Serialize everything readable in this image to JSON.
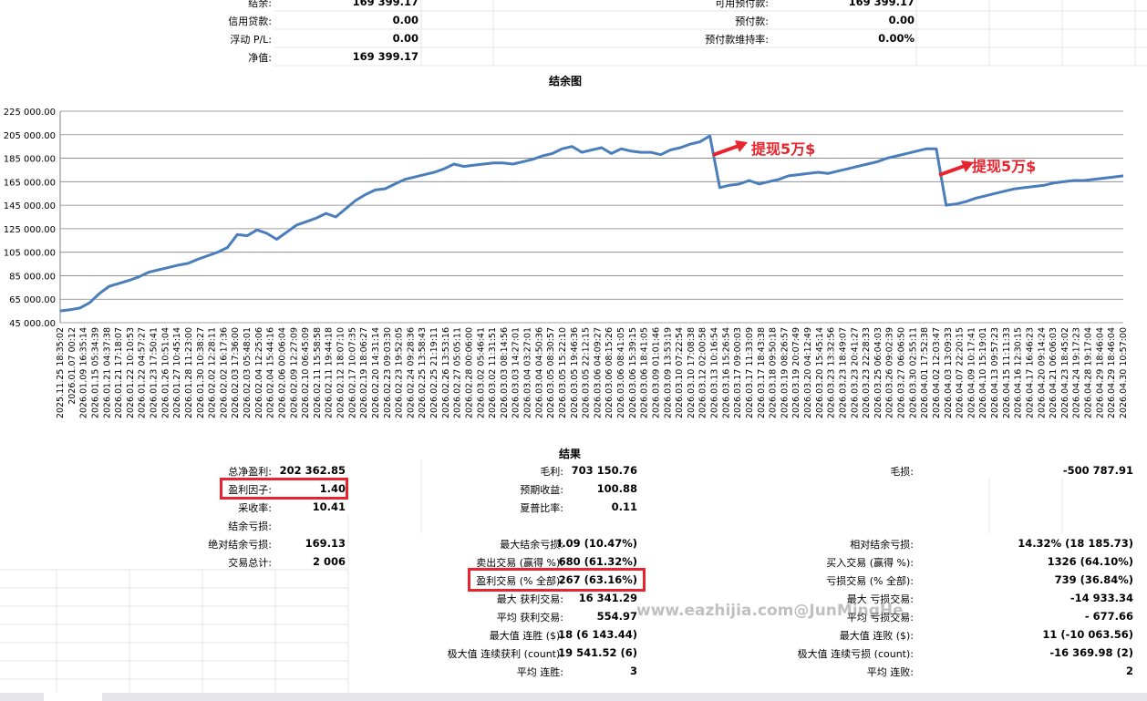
{
  "summary_top": [
    {
      "left_label": "结余:",
      "left_value": "169 399.17",
      "right_label": "可用预付款:",
      "right_value": "169 399.17"
    },
    {
      "left_label": "信用贷款:",
      "left_value": "0.00",
      "right_label": "预付款:",
      "right_value": "0.00"
    },
    {
      "left_label": "浮动 P/L:",
      "left_value": "0.00",
      "right_label": "预付款维持率:",
      "right_value": "0.00%"
    },
    {
      "left_label": "净值:",
      "left_value": "169 399.17",
      "right_label": "",
      "right_value": ""
    }
  ],
  "chart_title": "结余图",
  "annotations": {
    "withdraw1": "提现5万$",
    "withdraw2": "提现5万$"
  },
  "watermark": "www.eazhijia.com@JunMingHe",
  "results_title": "结果",
  "col1": [
    {
      "label": "总净盈利:",
      "value": "202 362.85"
    },
    {
      "label": "盈利因子:",
      "value": "1.40"
    },
    {
      "label": "采收率:",
      "value": "10.41"
    },
    {
      "label": "结余亏损:",
      "value": ""
    },
    {
      "label": "绝对结余亏损:",
      "value": "169.13"
    },
    {
      "label": "交易总计:",
      "value": "2 006"
    }
  ],
  "col2": [
    {
      "label": "毛利:",
      "value": "703 150.76"
    },
    {
      "label": "预期收益:",
      "value": "100.88"
    },
    {
      "label": "夏普比率:",
      "value": "0.11"
    },
    {
      "label": "",
      "value": ""
    },
    {
      "label": "最大结余亏损:",
      "value": "I.09 (10.47%)"
    },
    {
      "label": "卖出交易 (赢得 %):",
      "value": "680 (61.32%)"
    },
    {
      "label": "盈利交易 (% 全部):",
      "value": "267 (63.16%)"
    },
    {
      "label": "最大 获利交易:",
      "value": "16 341.29"
    },
    {
      "label": "平均 获利交易:",
      "value": "554.97"
    },
    {
      "label": "最大值 连胜 ($):",
      "value": "18 (6 143.44)"
    },
    {
      "label": "极大值 连续获利 (count):",
      "value": "19 541.52 (6)"
    },
    {
      "label": "平均 连胜:",
      "value": "3"
    }
  ],
  "col3": [
    {
      "label": "毛损:",
      "value": "-500 787.91"
    },
    {
      "label": "",
      "value": ""
    },
    {
      "label": "",
      "value": ""
    },
    {
      "label": "",
      "value": ""
    },
    {
      "label": "相对结余亏损:",
      "value": "14.32% (18 185.73)"
    },
    {
      "label": "买入交易 (赢得 %):",
      "value": "1326 (64.10%)"
    },
    {
      "label": "亏损交易 (% 全部):",
      "value": "739 (36.84%)"
    },
    {
      "label": "最大 亏损交易:",
      "value": "-14 933.34"
    },
    {
      "label": "平均 亏损交易:",
      "value": "- 677.66"
    },
    {
      "label": "最大值 连败 ($):",
      "value": "11 (-10 063.56)"
    },
    {
      "label": "极大值 连续亏损 (count):",
      "value": "-16 369.98 (2)"
    },
    {
      "label": "平均 连败:",
      "value": "2"
    }
  ],
  "chart_data": {
    "type": "line",
    "title": "结余图",
    "ylim": [
      45000,
      225000
    ],
    "y_ticks": [
      "45 000.00",
      "65 000.00",
      "85 000.00",
      "105 000.00",
      "125 000.00",
      "145 000.00",
      "165 000.00",
      "185 000.00",
      "205 000.00",
      "225 000.00"
    ],
    "x_ticks": [
      "2025.11.25 18:35:02",
      "2026.01.07 00:12",
      "2026.01.09 16:35:14",
      "2026.01.15 05:34:39",
      "2026.01.21 04:37:38",
      "2026.01.21 17:18:07",
      "2026.01.22 10:10:53",
      "2026.01.22 04:57:27",
      "2026.01.23 17:50:41",
      "2026.01.26 10:51:04",
      "2026.01.27 10:45:14",
      "2026.01.28 11:23:00",
      "2026.01.30 10:38:27",
      "2026.02.02 12:28:11",
      "2026.02.02 16:17:36",
      "2026.02.03 17:36:00",
      "2026.02.03 05:48:01",
      "2026.02.04 12:25:06",
      "2026.02.04 15:44:16",
      "2026.02.06 00:06:04",
      "2026.02.09 12:27:09",
      "2026.02.10 06:45:09",
      "2026.02.11 15:58:58",
      "2026.02.11 19:44:18",
      "2026.02.12 18:07:10",
      "2026.02.17 10:07:35",
      "2026.02.19 18:06:27",
      "2026.02.20 14:31:14",
      "2026.02.23 09:03:30",
      "2026.02.23 19:52:05",
      "2026.02.24 09:28:36",
      "2026.02.25 13:58:43",
      "2026.02.25 21:19:11",
      "2026.02.26 13:53:16",
      "2026.02.27 05:05:11",
      "2026.02.28 00:06:00",
      "2026.03.02 05:46:41",
      "2026.03.02 11:31:51",
      "2026.03.03 08:14:56",
      "2026.03.03 14:27:01",
      "2026.03.04 03:27:01",
      "2026.03.04 04:50:36",
      "2026.03.05 08:30:57",
      "2026.03.05 15:22:10",
      "2026.03.05 19:46:36",
      "2026.03.05 22:12:15",
      "2026.03.06 04:09:27",
      "2026.03.06 08:15:26",
      "2026.03.06 08:41:05",
      "2026.03.06 15:39:15",
      "2026.03.06 18:41:05",
      "2026.03.09 01:01:46",
      "2026.03.09 13:53:19",
      "2026.03.10 07:22:54",
      "2026.03.10 17:08:38",
      "2026.03.12 02:00:58",
      "2026.03.13 10:16:54",
      "2026.03.16 15:26:54",
      "2026.03.17 09:00:03",
      "2026.03.17 11:33:09",
      "2026.03.17 18:43:38",
      "2026.03.18 09:50:18",
      "2026.03.19 08:26:57",
      "2026.03.19 20:07:49",
      "2026.03.20 04:12:49",
      "2026.03.20 15:45:14",
      "2026.03.23 13:32:56",
      "2026.03.23 18:49:07",
      "2026.03.23 20:41:27",
      "2026.03.23 22:28:33",
      "2026.03.25 06:04:03",
      "2026.03.26 09:02:39",
      "2026.03.27 06:06:50",
      "2026.03.30 02:55:11",
      "2026.04.01 17:52:38",
      "2026.04.02 12:03:47",
      "2026.04.03 13:09:33",
      "2026.04.07 22:20:15",
      "2026.04.09 10:17:41",
      "2026.04.10 15:19:01",
      "2026.04.13 09:57:23",
      "2026.04.15 11:11:33",
      "2026.04.16 12:30:15",
      "2026.04.17 16:46:23",
      "2026.04.20 09:14:24",
      "2026.04.21 06:06:03",
      "2026.04.23 18:45:02",
      "2026.04.24 19:17:23",
      "2026.04.28 19:17:04",
      "2026.04.29 18:46:04",
      "2026.04.29 18:46:04",
      "2026.04.30 10:57:00"
    ],
    "series": [
      {
        "values": [
          55000,
          56000,
          57500,
          62000,
          70000,
          76000,
          78500,
          81000,
          84000,
          88000,
          90000,
          92000,
          94000,
          95500,
          99000,
          102000,
          105000,
          109000,
          120000,
          119000,
          124000,
          121000,
          116000,
          122000,
          128000,
          131000,
          134000,
          138000,
          135000,
          142000,
          149000,
          154000,
          158000,
          159000,
          163000,
          167000,
          169000,
          171000,
          173000,
          176000,
          180000,
          178000,
          179000,
          180000,
          181000,
          181000,
          180000,
          182000,
          184000,
          187000,
          189000,
          193000,
          195000,
          190000,
          192000,
          194000,
          189000,
          193000,
          191000,
          190000,
          190000,
          188000,
          192000,
          194000,
          197000,
          199000,
          204000,
          160000,
          162000,
          163000,
          166000,
          163000,
          165000,
          167000,
          170000,
          171000,
          172000,
          173000,
          172000,
          174000,
          176000,
          178000,
          180000,
          182000,
          185000,
          187000,
          189000,
          191000,
          193000,
          193000,
          145000,
          146000,
          148000,
          151000,
          153000,
          155000,
          157000,
          159000,
          160000,
          161000,
          162000,
          164000,
          165000,
          166000,
          166000,
          167000,
          168000,
          169000,
          170000
        ]
      }
    ],
    "grid": true
  }
}
